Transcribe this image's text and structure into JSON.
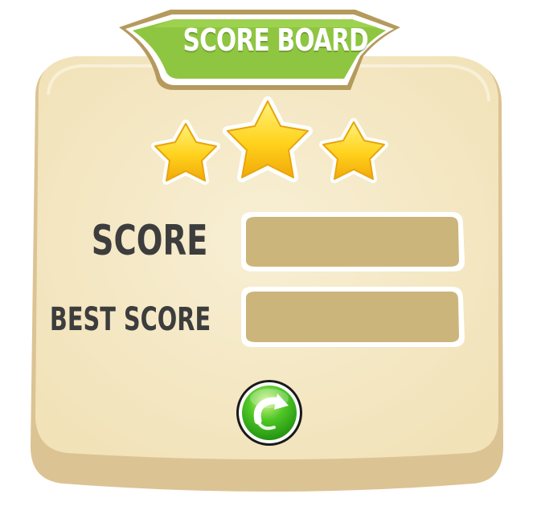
{
  "title": "SCORE BOARD",
  "rating": {
    "stars_earned": 3,
    "stars_total": 3
  },
  "score": {
    "label": "SCORE",
    "value": ""
  },
  "best_score": {
    "label": "BEST SCORE",
    "value": ""
  },
  "restart_button": {
    "icon": "restart-arrow-icon"
  },
  "colors": {
    "panel": "#f5e9c6",
    "panel_edge": "#dcc394",
    "banner_green": "#8fc641",
    "banner_frame": "#b59a5e",
    "field": "#cbb57a",
    "star": "#ffd21c",
    "label_text": "#3d3d3d",
    "button_green": "#33b81c"
  }
}
